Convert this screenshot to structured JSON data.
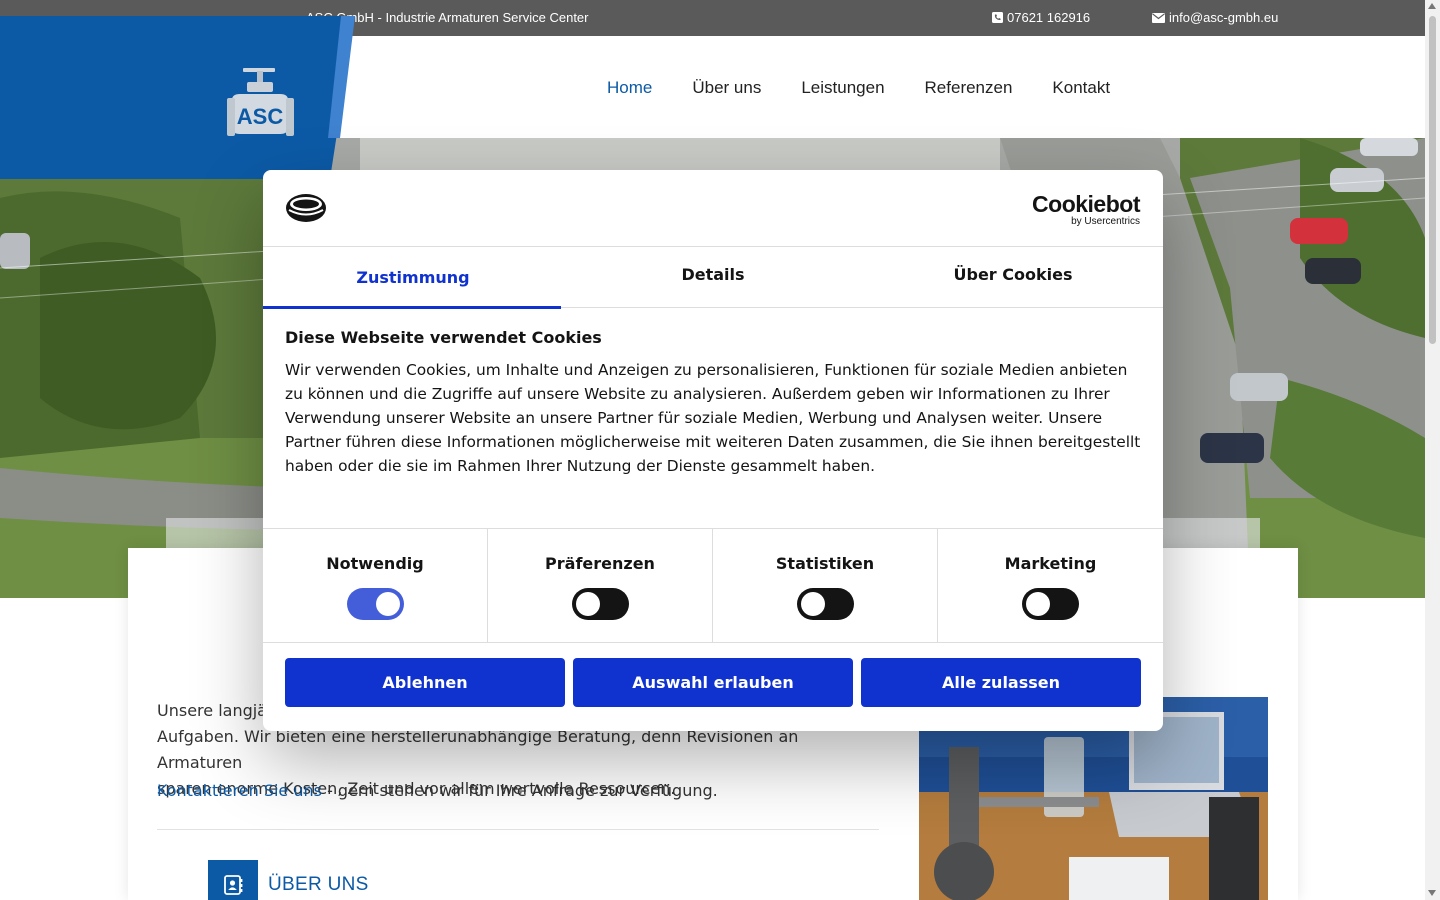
{
  "topbar": {
    "company": "ASC GmbH - Industrie Armaturen Service Center",
    "phone": "07621 162916",
    "email": "info@asc-gmbh.eu"
  },
  "logo": {
    "text": "ASC"
  },
  "nav": {
    "items": [
      {
        "label": "Home",
        "active": true
      },
      {
        "label": "Über uns"
      },
      {
        "label": "Leistungen"
      },
      {
        "label": "Referenzen"
      },
      {
        "label": "Kontakt"
      }
    ]
  },
  "colors": {
    "brand_blue": "#0c5aa6",
    "cookie_blue": "#1032cf",
    "topbar": "#5a5a5a"
  },
  "content": {
    "intro_visible_start": "Unsere langjä",
    "intro_line2": "Aufgaben. Wir bieten eine herstellerunabhängige Beratung, denn Revisionen an Armaturen",
    "intro_line3": "sparen enorme Kosten, Zeit und vor allem wertvolle Ressourcen.",
    "contact_link": "Kontaktieren Sie uns",
    "contact_rest": " - gern stehen wir für Ihre Anfrage zur Verfügung.",
    "section_title": "ÜBER UNS",
    "section_icon": "address-book-icon"
  },
  "cookie": {
    "brand": "Cookiebot",
    "brand_sub": "by Usercentrics",
    "tabs": [
      "Zustimmung",
      "Details",
      "Über Cookies"
    ],
    "active_tab": "Zustimmung",
    "heading": "Diese Webseite verwendet Cookies",
    "body": "Wir verwenden Cookies, um Inhalte und Anzeigen zu personalisieren, Funktionen für soziale Medien anbieten zu können und die Zugriffe auf unsere Website zu analysieren. Außerdem geben wir Informationen zu Ihrer Verwendung unserer Website an unsere Partner für soziale Medien, Werbung und Analysen weiter. Unsere Partner führen diese Informationen möglicherweise mit weiteren Daten zusammen, die Sie ihnen bereitgestellt haben oder die sie im Rahmen Ihrer Nutzung der Dienste gesammelt haben.",
    "toggles": [
      {
        "label": "Notwendig",
        "on": true
      },
      {
        "label": "Präferenzen",
        "on": false
      },
      {
        "label": "Statistiken",
        "on": false
      },
      {
        "label": "Marketing",
        "on": false
      }
    ],
    "buttons": [
      "Ablehnen",
      "Auswahl erlauben",
      "Alle zulassen"
    ]
  }
}
